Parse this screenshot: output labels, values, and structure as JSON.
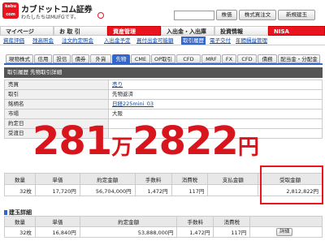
{
  "header": {
    "logo_line1": "kabu",
    "logo_line2": "com",
    "brand": "カブドットコム証券",
    "tagline": "わたしたちはMUFGです。",
    "buttons": [
      "株価",
      "株式買注文",
      "新規建玉"
    ]
  },
  "nav": {
    "items": [
      "マイページ",
      "お 取 引",
      "資産管理",
      "入出金・入出庫",
      "投資情報",
      "NISA"
    ],
    "active": "資産管理"
  },
  "subnav": {
    "items": [
      "資産評価",
      "残高照会",
      "注文約定照会",
      "入出金予定",
      "買付出金可能額",
      "取引履歴",
      "電子交付",
      "年間損益管理"
    ],
    "active": "取引履歴"
  },
  "tabs": {
    "items": [
      "現物株式",
      "信用",
      "投信",
      "債券",
      "外貨",
      "先物",
      "CME",
      "OP取引",
      "CFD",
      "MRF",
      "FX",
      "CFD",
      "債務",
      "配当金・分配金"
    ],
    "active": "先物"
  },
  "titlebar": "取引履歴 先物取引詳細",
  "details": [
    {
      "k": "売買",
      "v": "売り",
      "link": true
    },
    {
      "k": "取引",
      "v": "先物返済",
      "link": false
    },
    {
      "k": "銘柄名",
      "v": "日経225mini_03",
      "link": true
    },
    {
      "k": "市場",
      "v": "大阪",
      "link": false
    },
    {
      "k": "約定日",
      "v": "",
      "link": false
    },
    {
      "k": "受渡日",
      "v": "",
      "link": false
    }
  ],
  "overlay": {
    "part1": "281",
    "unit1": "万",
    "part2": "2822",
    "unit2": "円"
  },
  "summary": {
    "headers": [
      "数量",
      "単価",
      "約定金額",
      "手数料",
      "消費税",
      "支払金額",
      "受取金額"
    ],
    "row": [
      "32枚",
      "17,720円",
      "56,704,000円",
      "1,472円",
      "117円",
      "",
      "2,812,822円"
    ]
  },
  "section2": {
    "title": "建玉詳細",
    "headers": [
      "数量",
      "単価",
      "約定金額",
      "手数料",
      "消費税",
      ""
    ],
    "row": [
      "32枚",
      "16,840円",
      "53,888,000円",
      "1,472円",
      "117円",
      "詳細"
    ]
  }
}
